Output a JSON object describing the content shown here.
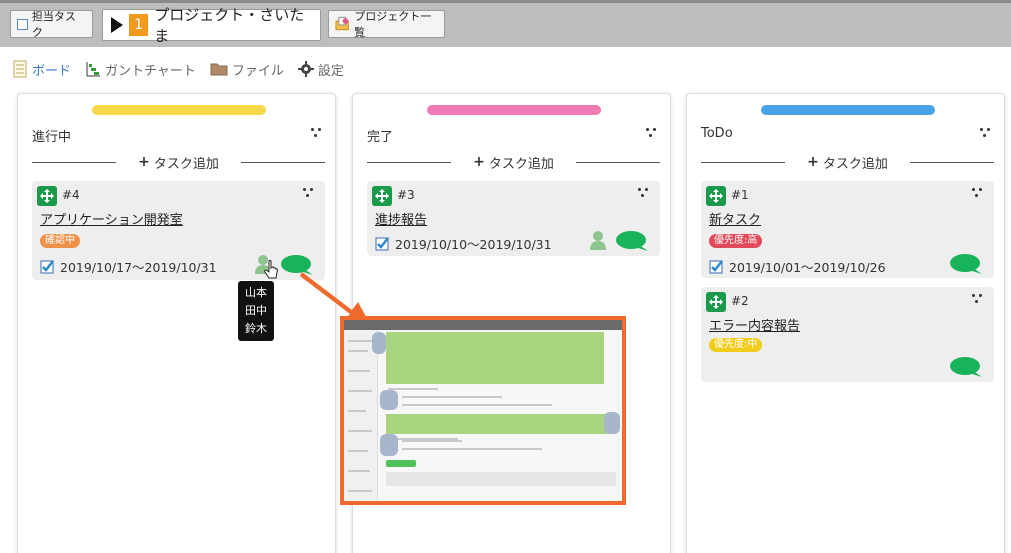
{
  "toolbar": {
    "my_task_label": "担当タスク",
    "project_number": "1",
    "project_name": "プロジェクト・さいたま",
    "project_list_label": "プロジェクト一覧"
  },
  "tabs": [
    {
      "label": "ボード",
      "icon": "notebook-icon",
      "active": true
    },
    {
      "label": "ガントチャート",
      "icon": "bar-chart-icon",
      "active": false
    },
    {
      "label": "ファイル",
      "icon": "folder-icon",
      "active": false
    },
    {
      "label": "設定",
      "icon": "gear-icon",
      "active": false
    }
  ],
  "columns": [
    {
      "title": "進行中",
      "color": "#f5d94a",
      "add_label": "タスク追加",
      "cards": [
        {
          "id": "#4",
          "title": "アプリケーション開発室",
          "tag": "確認中",
          "tag_color": "#f0914a",
          "dates": "2019/10/17～2019/10/31"
        }
      ]
    },
    {
      "title": "完了",
      "color": "#f07ab4",
      "add_label": "タスク追加",
      "cards": [
        {
          "id": "#3",
          "title": "進捗報告",
          "dates": "2019/10/10～2019/10/31"
        }
      ]
    },
    {
      "title": "ToDo",
      "color": "#4aa3e8",
      "add_label": "タスク追加",
      "cards": [
        {
          "id": "#1",
          "title": "新タスク",
          "tag": "優先度:高",
          "tag_color": "#e04a5a",
          "dates": "2019/10/01～2019/10/26"
        },
        {
          "id": "#2",
          "title": "エラー内容報告",
          "tag": "優先度:中",
          "tag_color": "#f2cc1a"
        }
      ]
    }
  ],
  "tooltip": {
    "members": [
      "山本",
      "田中",
      "鈴木"
    ]
  },
  "colors": {
    "accent_green": "#1a9a4a",
    "chat_green": "#18b35a",
    "callout_orange": "#ef6a2c"
  }
}
